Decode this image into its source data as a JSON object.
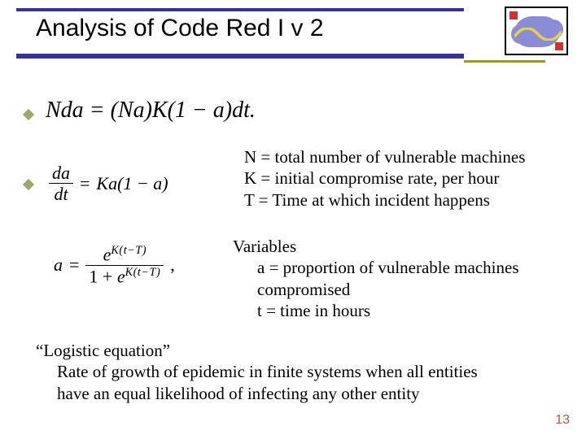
{
  "title": "Analysis of Code Red I v 2",
  "equations": {
    "eq1": "Nda = (Na)K(1 − a)dt.",
    "eq2_lhs_num": "da",
    "eq2_lhs_den": "dt",
    "eq2_rhs": "Ka(1 − a)",
    "eq3_lhs": "a",
    "eq3_num_base": "e",
    "eq3_num_exp": "K(t−T)",
    "eq3_den_prefix": "1 + ",
    "eq3_den_base": "e",
    "eq3_den_exp": "K(t−T)",
    "eq3_punct": ","
  },
  "defs1": {
    "n": "N = total number of vulnerable machines",
    "k": "K = initial compromise rate, per hour",
    "t": "T = Time at which incident happens"
  },
  "defs2": {
    "heading": "Variables",
    "a1": "a = proportion of vulnerable machines",
    "a2": "compromised",
    "t": "t = time in hours"
  },
  "footer": {
    "l1": "“Logistic equation”",
    "l2": "Rate of growth of epidemic in finite systems when all entities",
    "l3": "have an equal likelihood of infecting any other entity"
  },
  "page": "13"
}
